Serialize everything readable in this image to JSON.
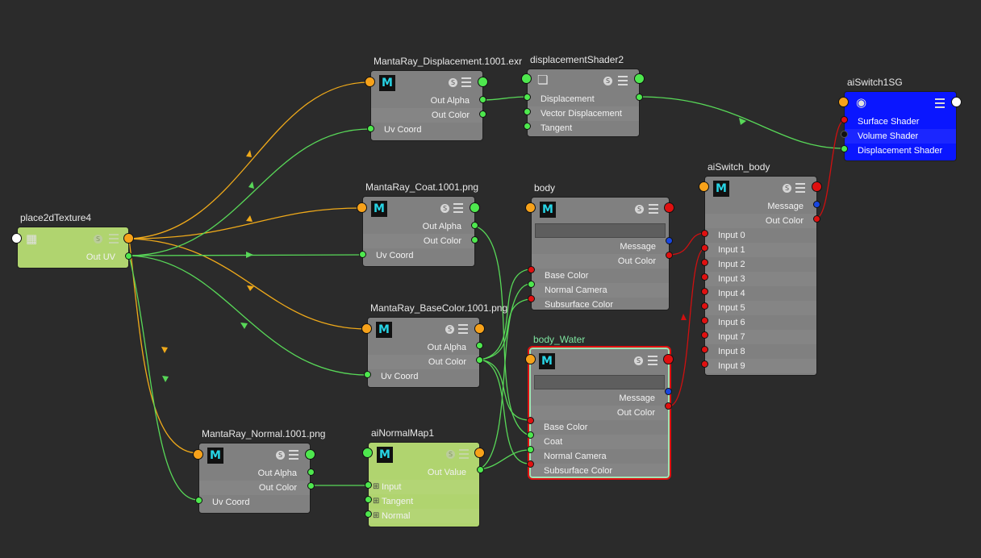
{
  "nodes": {
    "place2d": {
      "title": "place2dTexture4",
      "out_uv": "Out UV"
    },
    "disp_tex": {
      "title": "MantaRay_Displacement.1001.exr",
      "badge": "M",
      "out_alpha": "Out Alpha",
      "out_color": "Out Color",
      "uv_coord": "Uv Coord"
    },
    "disp_shader": {
      "title": "displacementShader2",
      "displacement": "Displacement",
      "vector_displacement": "Vector Displacement",
      "tangent": "Tangent"
    },
    "aiswitch_sg": {
      "title": "aiSwitch1SG",
      "surface_shader": "Surface Shader",
      "volume_shader": "Volume Shader",
      "displacement_shader": "Displacement Shader"
    },
    "coat_tex": {
      "title": "MantaRay_Coat.1001.png",
      "badge": "M",
      "out_alpha": "Out Alpha",
      "out_color": "Out Color",
      "uv_coord": "Uv Coord"
    },
    "body": {
      "title": "body",
      "badge": "M",
      "message": "Message",
      "out_color": "Out Color",
      "base_color": "Base Color",
      "normal_camera": "Normal Camera",
      "subsurface_color": "Subsurface Color"
    },
    "aiswitch_body": {
      "title": "aiSwitch_body",
      "badge": "M",
      "message": "Message",
      "out_color": "Out Color",
      "inputs": [
        "Input 0",
        "Input 1",
        "Input 2",
        "Input 3",
        "Input 4",
        "Input 5",
        "Input 6",
        "Input 7",
        "Input 8",
        "Input 9"
      ]
    },
    "base_tex": {
      "title": "MantaRay_BaseColor.1001.png",
      "badge": "M",
      "out_alpha": "Out Alpha",
      "out_color": "Out Color",
      "uv_coord": "Uv Coord"
    },
    "body_water": {
      "title": "body_Water",
      "badge": "M",
      "message": "Message",
      "out_color": "Out Color",
      "base_color": "Base Color",
      "coat": "Coat",
      "normal_camera": "Normal Camera",
      "subsurface_color": "Subsurface Color"
    },
    "normal_tex": {
      "title": "MantaRay_Normal.1001.png",
      "badge": "M",
      "out_alpha": "Out Alpha",
      "out_color": "Out Color",
      "uv_coord": "Uv Coord"
    },
    "ainormal": {
      "title": "aiNormalMap1",
      "badge": "M",
      "out_value": "Out Value",
      "input": "Input",
      "tangent": "Tangent",
      "normal": "Normal"
    }
  },
  "icons": {
    "shader_badge": "maya-shader-m-icon",
    "swatch": "swatch-s-icon",
    "attr_menu": "hamburger-menu-icon",
    "displacement": "cube-icon",
    "shading_group": "sphere-icon",
    "place2d": "checker-icon"
  },
  "colors": {
    "background": "#2b2b2b",
    "node": "#808080",
    "node_green": "#b0d46f",
    "node_blue": "#0a16ff",
    "wire_green": "#58d858",
    "wire_orange": "#f0aa1a",
    "wire_red": "#d01010",
    "selected_outline": "#e01010",
    "badge_text": "#27d3e4"
  }
}
